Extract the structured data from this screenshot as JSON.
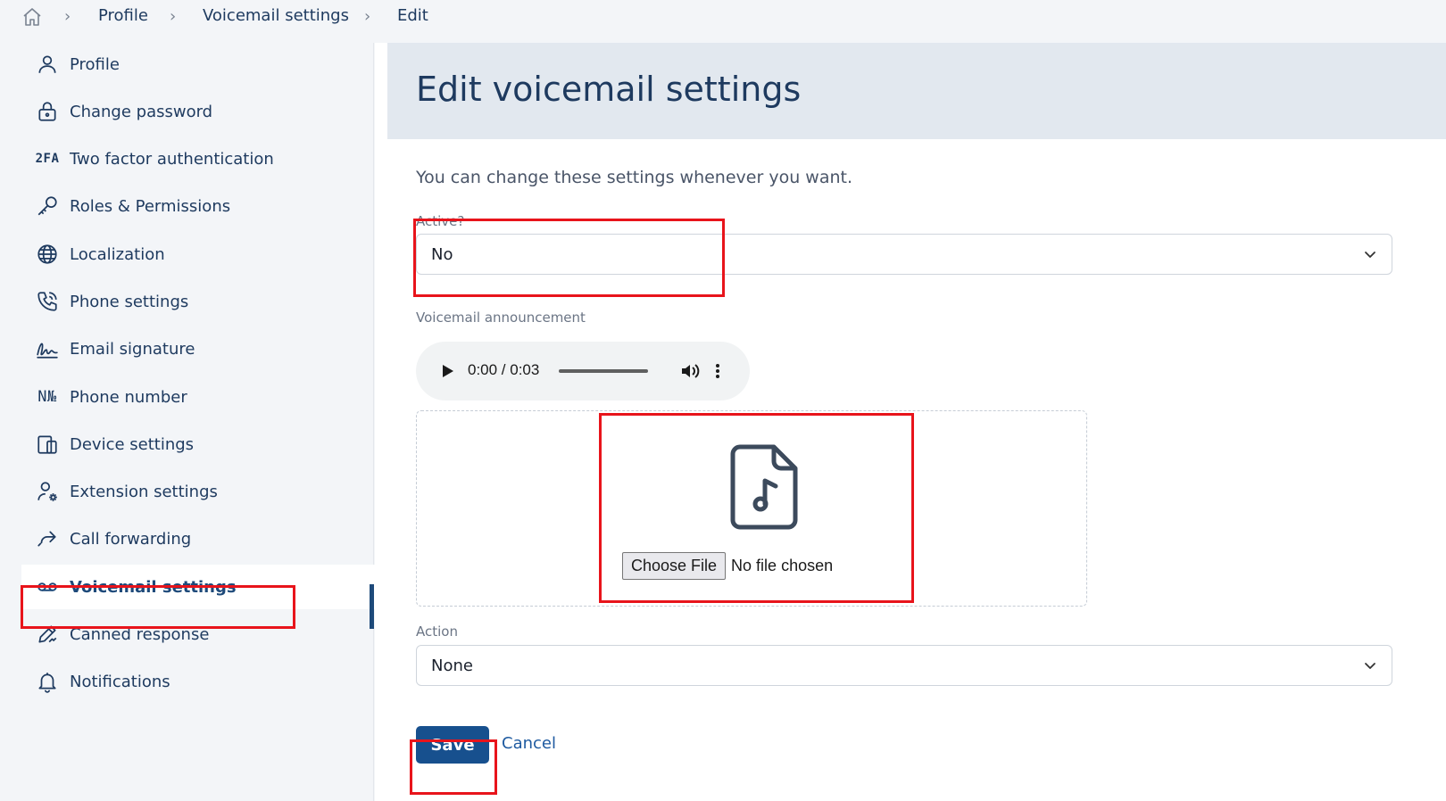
{
  "breadcrumb": {
    "home_icon": "home-icon",
    "items": [
      "Profile",
      "Voicemail settings",
      "Edit"
    ]
  },
  "sidebar": {
    "items": [
      {
        "label": "Profile",
        "icon": "user-icon"
      },
      {
        "label": "Change password",
        "icon": "lock-icon"
      },
      {
        "label": "Two factor authentication",
        "icon": "2fa-text-icon",
        "icon_text": "2FA"
      },
      {
        "label": "Roles & Permissions",
        "icon": "key-icon"
      },
      {
        "label": "Localization",
        "icon": "globe-icon"
      },
      {
        "label": "Phone settings",
        "icon": "phone-icon"
      },
      {
        "label": "Email signature",
        "icon": "signature-icon"
      },
      {
        "label": "Phone number",
        "icon": "numero-icon",
        "icon_text": "N№"
      },
      {
        "label": "Device settings",
        "icon": "devices-icon"
      },
      {
        "label": "Extension settings",
        "icon": "user-gear-icon"
      },
      {
        "label": "Call forwarding",
        "icon": "forward-arrow-icon"
      },
      {
        "label": "Voicemail settings",
        "icon": "voicemail-icon",
        "active": true
      },
      {
        "label": "Canned response",
        "icon": "pencil-icon"
      },
      {
        "label": "Notifications",
        "icon": "bell-icon"
      }
    ]
  },
  "main": {
    "title": "Edit voicemail settings",
    "intro": "You can change these settings whenever you want.",
    "active_field": {
      "label": "Active?",
      "value": "No"
    },
    "announcement": {
      "label": "Voicemail announcement",
      "time": "0:00 / 0:03",
      "file_button": "Choose File",
      "file_status": "No file chosen"
    },
    "action_field": {
      "label": "Action",
      "value": "None"
    },
    "save_label": "Save",
    "cancel_label": "Cancel"
  },
  "colors": {
    "accent": "#17508e",
    "text": "#1e3a5f",
    "annotation": "#e8141b",
    "sidebar_bg": "#f3f5f8",
    "header_bg": "#e2e8ef"
  }
}
